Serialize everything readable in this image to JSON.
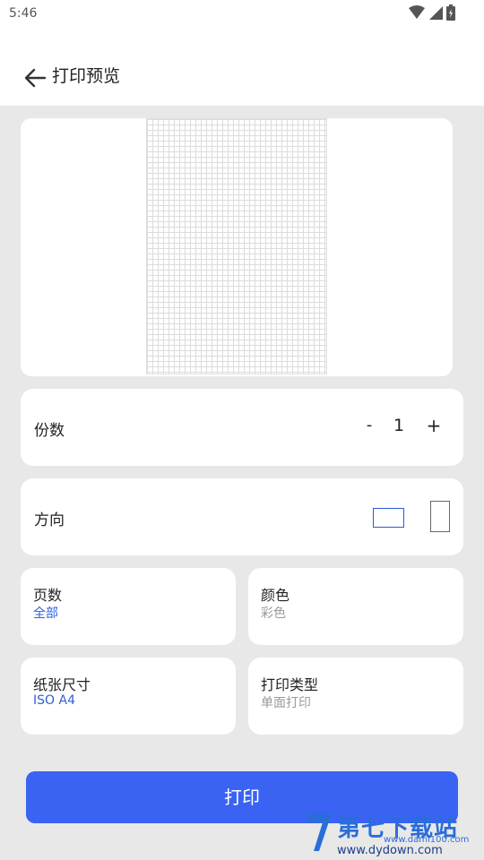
{
  "status_bar": {
    "time": "5:46",
    "icons": [
      "wifi-icon",
      "signal-icon",
      "battery-icon"
    ]
  },
  "app_bar": {
    "title": "打印预览",
    "back_icon": "arrow-back-icon"
  },
  "copies": {
    "label": "份数",
    "minus": "-",
    "value": "1",
    "plus": "+"
  },
  "orientation": {
    "label": "方向",
    "selected": "landscape"
  },
  "pages": {
    "title": "页数",
    "value": "全部"
  },
  "color": {
    "title": "颜色",
    "value": "彩色"
  },
  "paper_size": {
    "title": "纸张尺寸",
    "value": "ISO A4"
  },
  "print_type": {
    "title": "打印类型",
    "value": "单面打印"
  },
  "print_button": {
    "label": "打印"
  },
  "watermark": {
    "text": "第七下载站",
    "sub": "www.dami100.com",
    "url": "www.dydown.com"
  },
  "colors": {
    "accent": "#3a63f4",
    "link": "#2f5fd8",
    "background": "#e8e8e8"
  }
}
